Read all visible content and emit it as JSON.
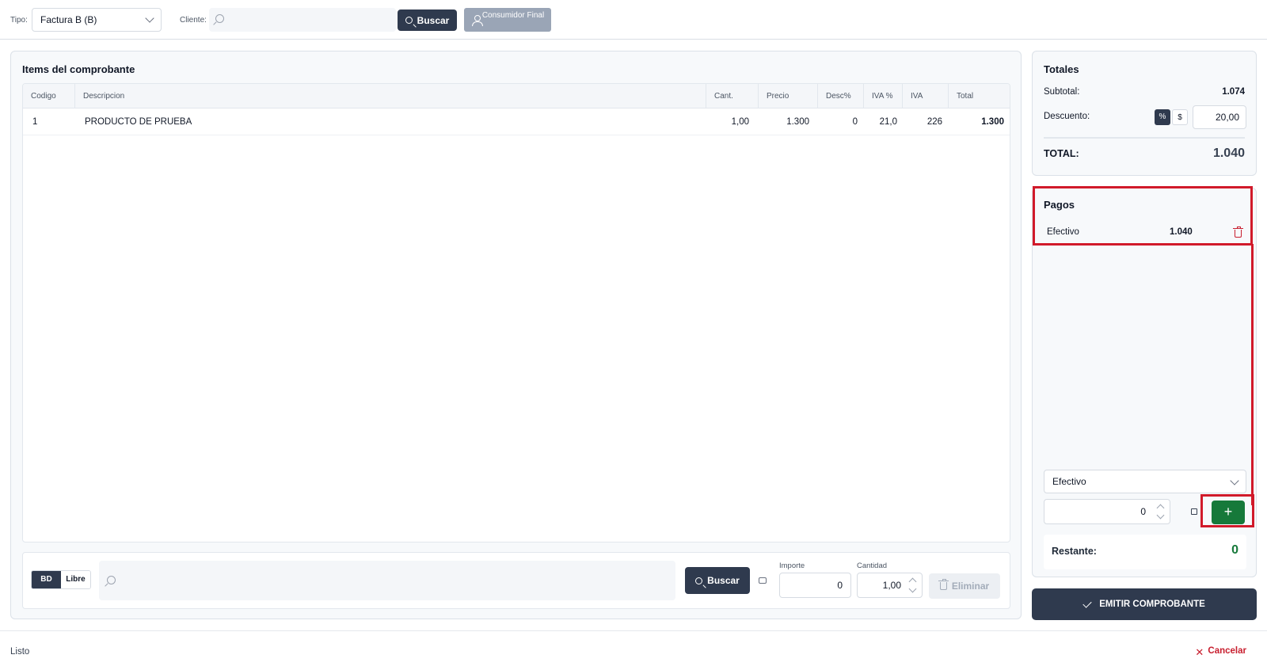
{
  "header": {
    "tipo_label": "Tipo:",
    "tipo_value": "Factura B (B)",
    "cliente_label": "Cliente:",
    "cliente_placeholder": "",
    "buscar_label": "Buscar",
    "consumidor_final_label": "Consumidor Final"
  },
  "items": {
    "title": "Items del comprobante",
    "columns": [
      "Codigo",
      "Descripcion",
      "Cant.",
      "Precio",
      "Desc%",
      "IVA %",
      "IVA",
      "Total"
    ],
    "rows": [
      {
        "codigo": "1",
        "descripcion": "PRODUCTO DE PRUEBA",
        "cant": "1,00",
        "precio": "1.300",
        "desc": "0",
        "iva_pct": "21,0",
        "iva": "226",
        "total": "1.300"
      }
    ],
    "bottom": {
      "bd_label": "BD",
      "libre_label": "Libre",
      "buscar_label": "Buscar",
      "importe_label": "Importe",
      "importe_value": "0",
      "cantidad_label": "Cantidad",
      "cantidad_value": "1,00",
      "eliminar_label": "Eliminar"
    }
  },
  "totales": {
    "title": "Totales",
    "subtotal_label": "Subtotal:",
    "subtotal_value": "1.074",
    "descuento_label": "Descuento:",
    "mode_percent": "%",
    "mode_amount": "$",
    "descuento_value": "20,00",
    "total_label": "TOTAL:",
    "total_value": "1.040"
  },
  "pagos": {
    "title": "Pagos",
    "items": [
      {
        "metodo": "Efectivo",
        "monto": "1.040"
      }
    ],
    "metodo_select": "Efectivo",
    "monto_value": "0",
    "add_label": "+",
    "restante_label": "Restante:",
    "restante_value": "0"
  },
  "emitir_label": "EMITIR COMPROBANTE",
  "footer": {
    "status": "Listo",
    "cancelar_label": "Cancelar"
  },
  "colors": {
    "primary": "#2f3a4e",
    "success": "#16793a",
    "danger": "#c81e2e",
    "highlight": "#d11a2a"
  }
}
